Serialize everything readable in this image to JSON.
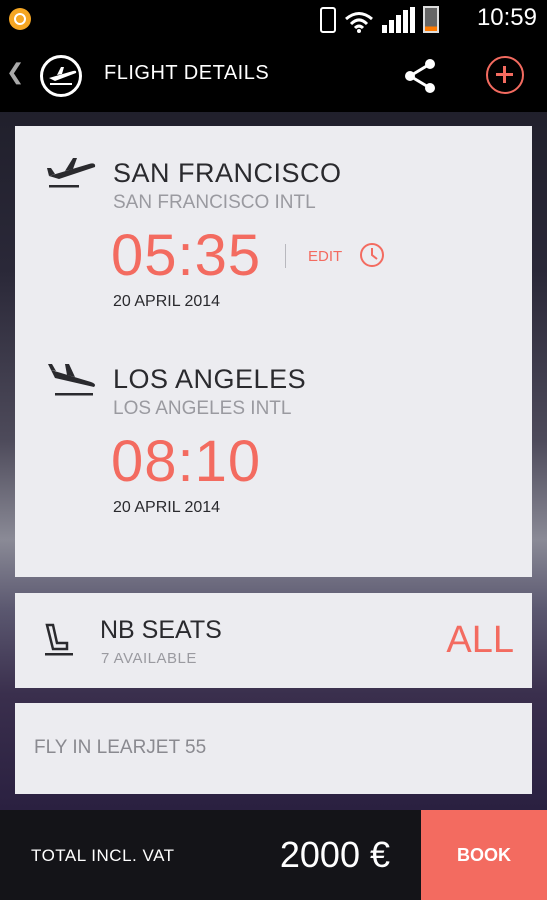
{
  "status_bar": {
    "time": "10:59",
    "icons": [
      "app-notification-icon",
      "phone-vibrate-icon",
      "wifi-icon",
      "signal-icon",
      "battery-icon"
    ]
  },
  "app_bar": {
    "back_icon": "chevron-left-icon",
    "logo_icon": "plane-logo-icon",
    "title": "FLIGHT DETAILS",
    "share_icon": "share-icon",
    "add_icon": "plus-circle-icon"
  },
  "departure": {
    "icon": "takeoff-icon",
    "city": "SAN FRANCISCO",
    "airport": "SAN FRANCISCO INTL",
    "time": "05:35",
    "date": "20 APRIL 2014",
    "edit_label": "EDIT",
    "edit_icon": "clock-icon"
  },
  "arrival": {
    "icon": "landing-icon",
    "city": "LOS ANGELES",
    "airport": "LOS ANGELES INTL",
    "time": "08:10",
    "date": "20 APRIL 2014"
  },
  "seats": {
    "icon": "seat-icon",
    "title": "NB SEATS",
    "subtitle": "7 AVAILABLE",
    "value": "ALL"
  },
  "note": {
    "text": "FLY IN LEARJET 55"
  },
  "footer": {
    "total_label": "TOTAL INCL. VAT",
    "total_price": "2000 €",
    "book_label": "BOOK"
  },
  "colors": {
    "accent": "#f36b60",
    "card": "#ececf0",
    "bar": "#000000"
  }
}
